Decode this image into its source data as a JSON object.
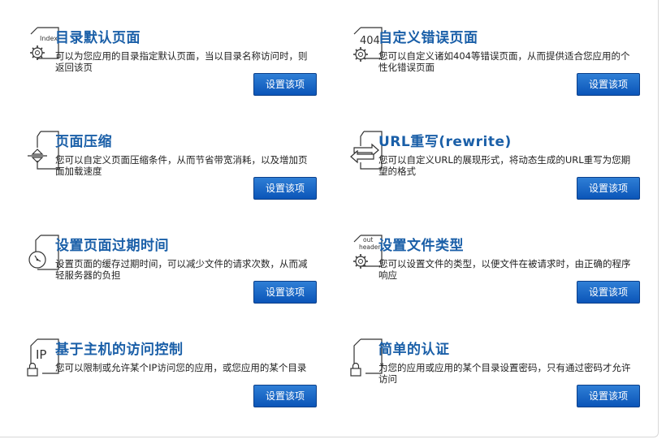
{
  "cards": [
    {
      "title": "目录默认页面",
      "desc": "可以为您应用的目录指定默认页面，当以目录名称访问时，则返回该页",
      "button": "设置该项",
      "icon": "index-gear-icon",
      "icon_text": "Index"
    },
    {
      "title": "自定义错误页面",
      "desc": "您可以自定义诸如404等错误页面，从而提供适合您应用的个性化错误页面",
      "button": "设置该项",
      "icon": "error-404-gear-icon",
      "icon_text": "404"
    },
    {
      "title": "页面压缩",
      "desc": "您可以自定义页面压缩条件，从而节省带宽消耗，以及增加页面加载速度",
      "button": "设置该项",
      "icon": "compress-icon"
    },
    {
      "title": "URL重写(rewrite)",
      "desc": "您可以自定义URL的展现形式，将动态生成的URL重写为您期望的格式",
      "button": "设置该项",
      "icon": "rewrite-arrows-icon"
    },
    {
      "title": "设置页面过期时间",
      "desc": "设置页面的缓存过期时间，可以减少文件的请求次数，从而减轻服务器的负担",
      "button": "设置该项",
      "icon": "expire-clock-icon"
    },
    {
      "title": "设置文件类型",
      "desc": "您可以设置文件的类型，以便文件在被请求时，由正确的程序响应",
      "button": "设置该项",
      "icon": "header-gear-icon",
      "icon_text_1": "out",
      "icon_text_2": "header"
    },
    {
      "title": "基于主机的访问控制",
      "desc": "您可以限制或允许某个IP访问您的应用，或您应用的某个目录",
      "button": "设置该项",
      "icon": "ip-lock-icon",
      "icon_text": "IP"
    },
    {
      "title": "简单的认证",
      "desc": "为您的应用或应用的某个目录设置密码，只有通过密码才允许访问",
      "button": "设置该项",
      "icon": "auth-lock-icon"
    }
  ]
}
